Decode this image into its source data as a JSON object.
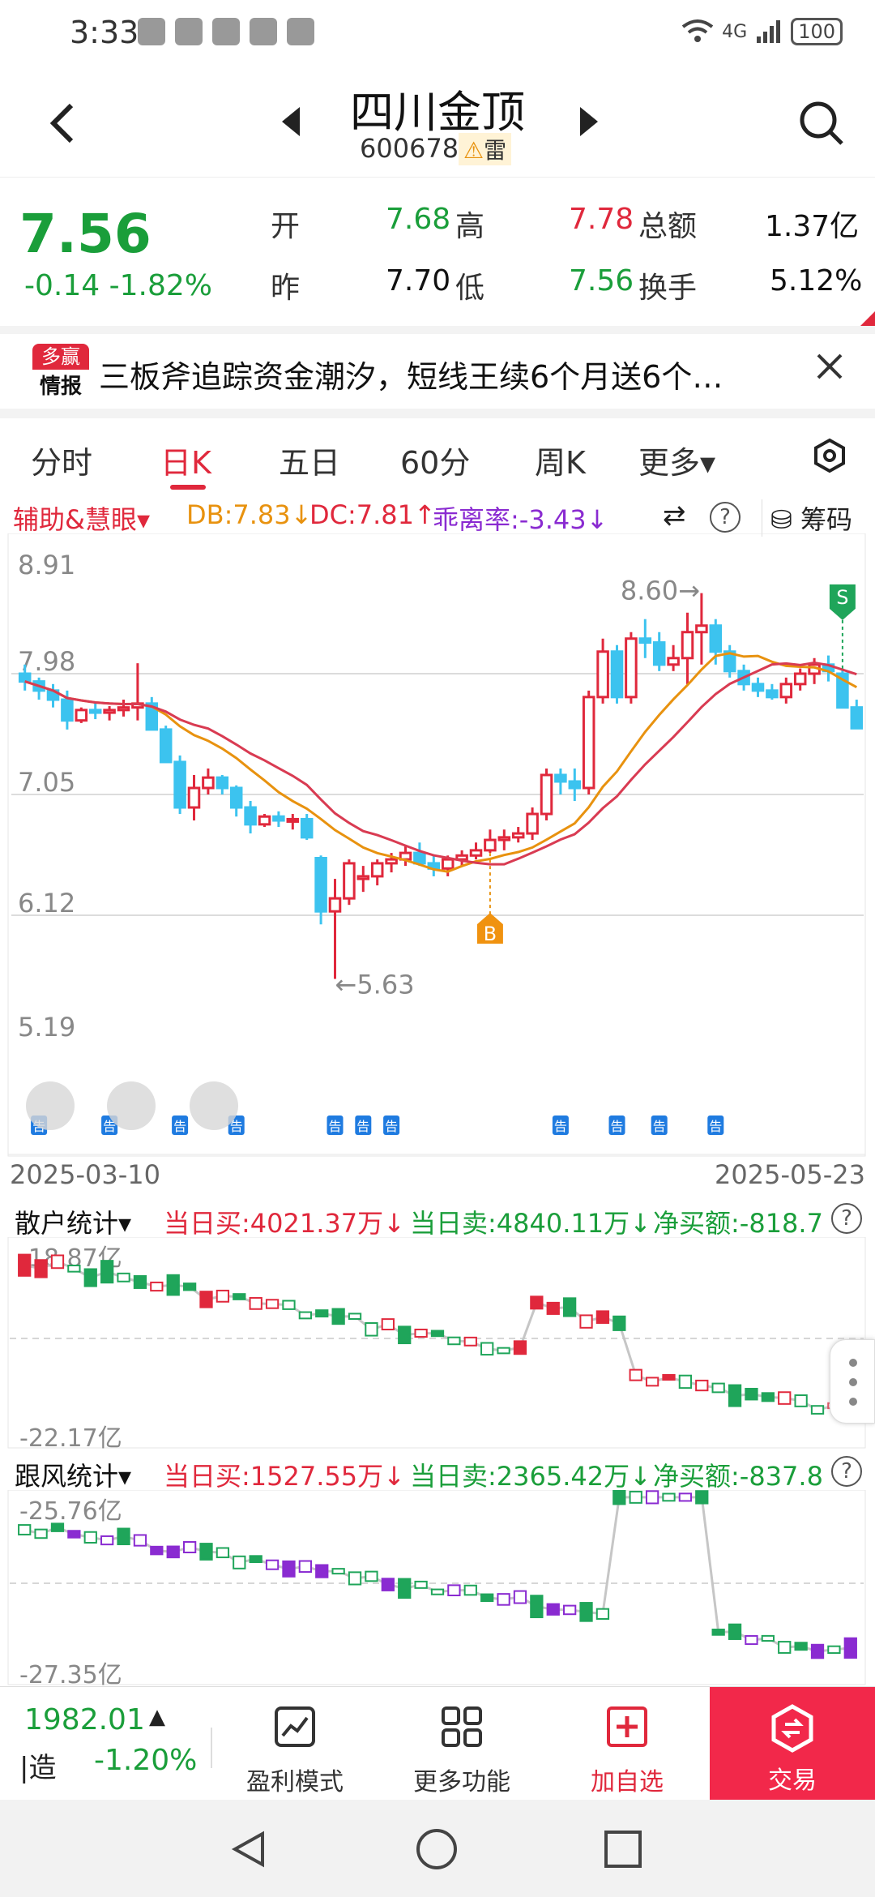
{
  "status": {
    "time": "3:33",
    "battery": "100",
    "network": "4G"
  },
  "nav": {
    "title": "四川金顶",
    "code": "600678",
    "tag": "雷"
  },
  "quote": {
    "price": "7.56",
    "change": "-0.14",
    "change_pct": "-1.82%",
    "open_label": "开",
    "open": "7.68",
    "high_label": "高",
    "high": "7.78",
    "amount_label": "总额",
    "amount": "1.37亿",
    "prev_label": "昨",
    "prev": "7.70",
    "low_label": "低",
    "low": "7.56",
    "turnover_label": "换手",
    "turnover": "5.12%"
  },
  "ad": {
    "logo_top": "多赢",
    "logo_bottom": "情报",
    "text": "三板斧追踪资金潮汐，短线王续6个月送6个…"
  },
  "tabs": [
    "分时",
    "日K",
    "五日",
    "60分",
    "周K",
    "更多▾"
  ],
  "indicator": {
    "name": "辅助&慧眼▾",
    "db": "DB:7.83↓",
    "dc": "DC:7.81↑",
    "bias": "乖离率:-3.43↓",
    "chips": "筹码"
  },
  "kchart": {
    "y_labels": [
      "8.91",
      "7.98",
      "7.05",
      "6.12",
      "5.19"
    ],
    "high_note": "8.60→",
    "low_note": "←5.63",
    "date_start": "2025-03-10",
    "date_end": "2025-05-23",
    "buy_marker": "B",
    "sell_marker": "S",
    "announce": "告"
  },
  "retail": {
    "name": "散户统计▾",
    "buy": "当日买:4021.37万↓",
    "sell": "当日卖:4840.11万↓",
    "net": "净买额:-818.7",
    "top": "-18.87亿",
    "bottom": "-22.17亿"
  },
  "follow": {
    "name": "跟风统计▾",
    "buy": "当日买:1527.55万↓",
    "sell": "当日卖:2365.42万↓",
    "net": "净买额:-837.8",
    "top": "-25.76亿",
    "bottom": "-27.35亿"
  },
  "bottom": {
    "index_value": "1982.01",
    "index_name": "|造",
    "index_change": "-1.20%",
    "btn1": "盈利模式",
    "btn2": "更多功能",
    "btn3": "加自选",
    "trade": "交易"
  },
  "chart_data": {
    "type": "candlestick",
    "ylim": [
      5.19,
      8.91
    ],
    "candles": [
      [
        7.98,
        8.05,
        7.85,
        7.92
      ],
      [
        7.92,
        7.95,
        7.78,
        7.85
      ],
      [
        7.85,
        7.9,
        7.72,
        7.78
      ],
      [
        7.78,
        7.85,
        7.55,
        7.62
      ],
      [
        7.62,
        7.72,
        7.6,
        7.7
      ],
      [
        7.7,
        7.75,
        7.63,
        7.68
      ],
      [
        7.68,
        7.73,
        7.62,
        7.7
      ],
      [
        7.7,
        7.78,
        7.65,
        7.72
      ],
      [
        7.72,
        8.06,
        7.62,
        7.75
      ],
      [
        7.75,
        7.8,
        7.6,
        7.55
      ],
      [
        7.55,
        7.58,
        7.3,
        7.3
      ],
      [
        7.3,
        7.35,
        6.9,
        6.95
      ],
      [
        6.95,
        7.2,
        6.85,
        7.1
      ],
      [
        7.1,
        7.25,
        7.05,
        7.18
      ],
      [
        7.18,
        7.2,
        7.05,
        7.1
      ],
      [
        7.1,
        7.12,
        6.88,
        6.95
      ],
      [
        6.95,
        7.0,
        6.75,
        6.82
      ],
      [
        6.82,
        6.9,
        6.8,
        6.88
      ],
      [
        6.88,
        6.92,
        6.8,
        6.85
      ],
      [
        6.85,
        6.9,
        6.78,
        6.86
      ],
      [
        6.86,
        6.9,
        6.7,
        6.72
      ],
      [
        6.56,
        6.58,
        6.05,
        6.15
      ],
      [
        6.15,
        6.4,
        5.63,
        6.25
      ],
      [
        6.25,
        6.55,
        6.2,
        6.52
      ],
      [
        6.4,
        6.5,
        6.3,
        6.42
      ],
      [
        6.42,
        6.55,
        6.35,
        6.52
      ],
      [
        6.52,
        6.6,
        6.45,
        6.55
      ],
      [
        6.55,
        6.65,
        6.5,
        6.6
      ],
      [
        6.6,
        6.68,
        6.5,
        6.52
      ],
      [
        6.52,
        6.58,
        6.42,
        6.48
      ],
      [
        6.48,
        6.58,
        6.42,
        6.55
      ],
      [
        6.55,
        6.62,
        6.5,
        6.58
      ],
      [
        6.58,
        6.68,
        6.55,
        6.62
      ],
      [
        6.62,
        6.78,
        6.6,
        6.7
      ],
      [
        6.7,
        6.78,
        6.62,
        6.72
      ],
      [
        6.72,
        6.8,
        6.68,
        6.75
      ],
      [
        6.75,
        6.95,
        6.7,
        6.9
      ],
      [
        6.9,
        7.25,
        6.85,
        7.2
      ],
      [
        7.2,
        7.25,
        7.05,
        7.15
      ],
      [
        7.15,
        7.25,
        7.0,
        7.1
      ],
      [
        7.1,
        7.85,
        7.05,
        7.8
      ],
      [
        7.8,
        8.25,
        7.75,
        8.15
      ],
      [
        8.15,
        8.2,
        7.75,
        7.8
      ],
      [
        7.8,
        8.3,
        7.75,
        8.25
      ],
      [
        8.25,
        8.4,
        8.1,
        8.22
      ],
      [
        8.22,
        8.3,
        8.0,
        8.05
      ],
      [
        8.05,
        8.2,
        8.0,
        8.1
      ],
      [
        8.1,
        8.45,
        7.9,
        8.3
      ],
      [
        8.3,
        8.6,
        8.05,
        8.35
      ],
      [
        8.35,
        8.4,
        8.05,
        8.15
      ],
      [
        8.15,
        8.2,
        7.95,
        8.0
      ],
      [
        8.0,
        8.05,
        7.85,
        7.9
      ],
      [
        7.9,
        7.95,
        7.8,
        7.85
      ],
      [
        7.85,
        7.9,
        7.78,
        7.8
      ],
      [
        7.8,
        7.95,
        7.75,
        7.9
      ],
      [
        7.9,
        8.02,
        7.85,
        7.98
      ],
      [
        7.98,
        8.1,
        7.9,
        8.05
      ],
      [
        8.05,
        8.12,
        7.92,
        8.0
      ],
      [
        7.98,
        8.02,
        7.85,
        7.72
      ],
      [
        7.72,
        7.78,
        7.56,
        7.56
      ]
    ]
  }
}
